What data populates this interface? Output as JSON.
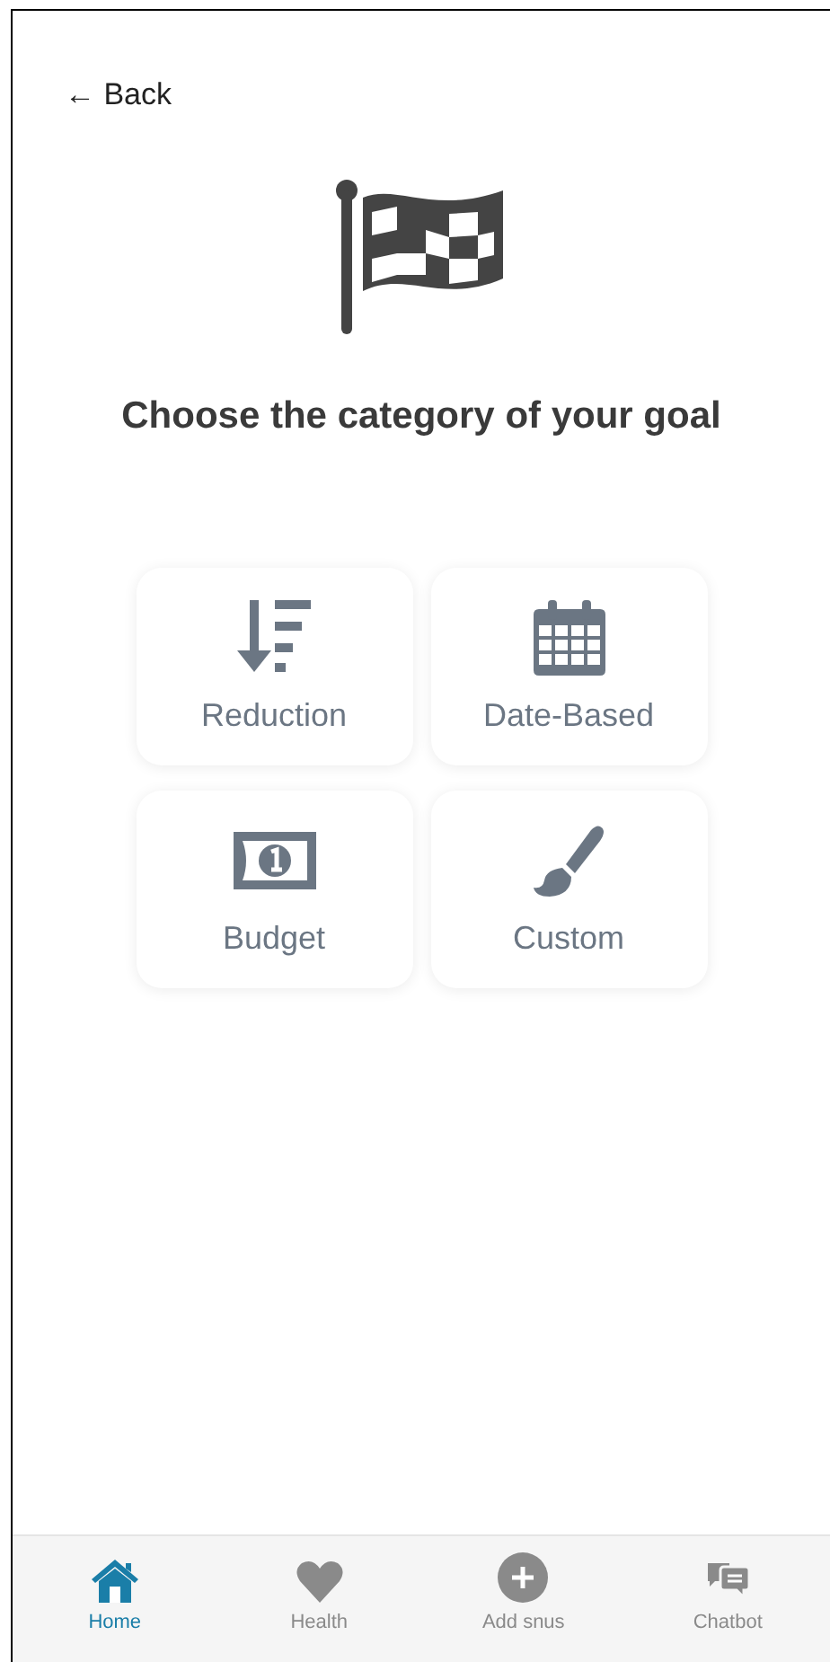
{
  "back": {
    "label": "← Back"
  },
  "title": "Choose the category of your goal",
  "categories": [
    {
      "kind": "reduction",
      "label": "Reduction"
    },
    {
      "kind": "date",
      "label": "Date-Based"
    },
    {
      "kind": "budget",
      "label": "Budget"
    },
    {
      "kind": "custom",
      "label": "Custom"
    }
  ],
  "tabs": [
    {
      "kind": "home",
      "label": "Home",
      "selected": true
    },
    {
      "kind": "health",
      "label": "Health",
      "selected": false
    },
    {
      "kind": "add",
      "label": "Add snus",
      "selected": false
    },
    {
      "kind": "chat",
      "label": "Chatbot",
      "selected": false
    }
  ]
}
